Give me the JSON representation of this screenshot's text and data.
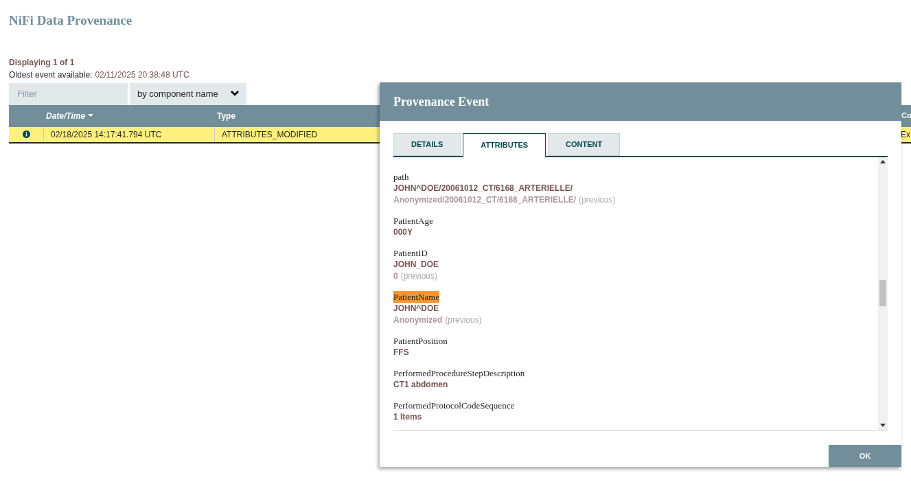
{
  "page": {
    "title": "NiFi Data Provenance",
    "displaying": "Displaying 1 of 1",
    "oldest_label": "Oldest event available:",
    "oldest_value": "02/11/2025 20:38:48 UTC"
  },
  "filter": {
    "placeholder": "Filter",
    "mode": "by component name"
  },
  "table": {
    "columns": [
      {
        "label": "Date/Time",
        "kind": "sorted"
      },
      {
        "label": "Type",
        "kind": "plain"
      },
      {
        "label": "Co",
        "kind": "edge"
      }
    ],
    "rows": [
      {
        "selected": true,
        "cells": [
          "02/18/2025 14:17:41.794 UTC",
          "ATTRIBUTES_MODIFIED",
          "Ex"
        ]
      }
    ]
  },
  "dialog": {
    "title": "Provenance Event",
    "tabs": [
      {
        "label": "DETAILS",
        "selected": false
      },
      {
        "label": "ATTRIBUTES",
        "selected": true
      },
      {
        "label": "CONTENT",
        "selected": false
      }
    ],
    "attributes": [
      {
        "name": "path",
        "highlighted": false,
        "value": "JOHN^DOE/20061012_CT/6168_ARTERIELLE/",
        "previous": "Anonymized/20061012_CT/6168_ARTERIELLE/",
        "previous_label": "(previous)"
      },
      {
        "name": "PatientAge",
        "highlighted": false,
        "value": "000Y"
      },
      {
        "name": "PatientID",
        "highlighted": false,
        "value": "JOHN_DOE",
        "previous": "0",
        "previous_label": "(previous)"
      },
      {
        "name": "PatientName",
        "highlighted": true,
        "value": "JOHN^DOE",
        "previous": "Anonymized",
        "previous_label": "(previous)"
      },
      {
        "name": "PatientPosition",
        "highlighted": false,
        "value": "FFS"
      },
      {
        "name": "PerformedProcedureStepDescription",
        "highlighted": false,
        "value": "CT1 abdomen"
      },
      {
        "name": "PerformedProtocolCodeSequence",
        "highlighted": false,
        "value": "1 Items"
      }
    ],
    "ok": "OK"
  }
}
